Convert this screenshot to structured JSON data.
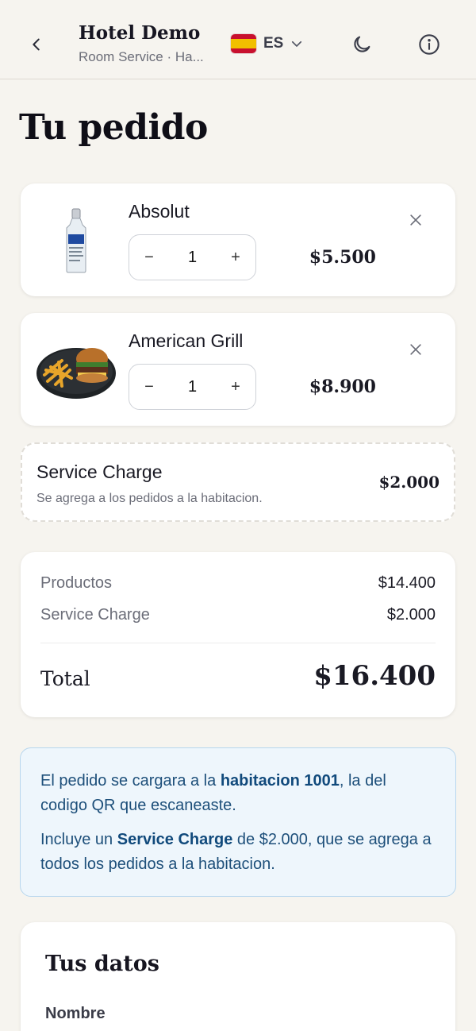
{
  "header": {
    "title": "Hotel Demo",
    "subtitle": "Room Service · Ha...",
    "lang_code": "ES",
    "icons": {
      "back": "chevron-left-icon",
      "lang_dropdown": "chevron-down-icon",
      "theme": "moon-icon",
      "info": "info-icon"
    }
  },
  "page_title": "Tu pedido",
  "cart": {
    "items": [
      {
        "name": "Absolut",
        "qty": "1",
        "price": "$5.500",
        "decrement": "−",
        "increment": "+"
      },
      {
        "name": "American Grill",
        "qty": "1",
        "price": "$8.900",
        "decrement": "−",
        "increment": "+"
      }
    ]
  },
  "service_charge": {
    "title": "Service Charge",
    "description": "Se agrega a los pedidos a la habitacion.",
    "price": "$2.000"
  },
  "summary": {
    "products_label": "Productos",
    "products_value": "$14.400",
    "service_label": "Service Charge",
    "service_value": "$2.000",
    "total_label": "Total",
    "total_value": "$16.400"
  },
  "info": {
    "p1_pre": "El pedido se cargara a la ",
    "p1_bold": "habitacion 1001",
    "p1_post": ", la del codigo QR que escaneaste.",
    "p2_pre": "Incluye un ",
    "p2_bold": "Service Charge",
    "p2_post": " de $2.000, que se agrega a todos los pedidos a la habitacion."
  },
  "datos": {
    "title": "Tus datos",
    "name_label": "Nombre"
  },
  "colors": {
    "background": "#f6f4ef",
    "info_bg": "#eef6fc",
    "info_text": "#1d4f7a",
    "flag_red": "#c8102e",
    "flag_yellow": "#f1bf00"
  }
}
